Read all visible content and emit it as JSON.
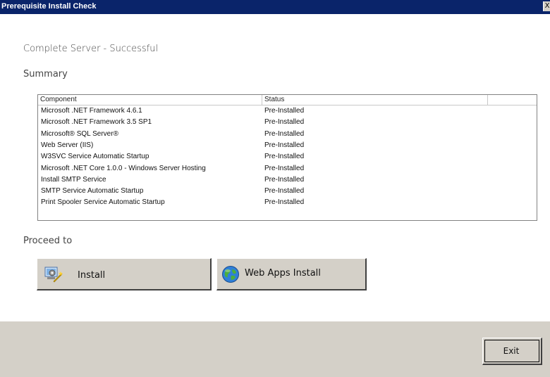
{
  "window": {
    "title": "Prerequisite Install Check",
    "close_glyph": "X"
  },
  "heading": "Complete Server - Successful",
  "summary_label": "Summary",
  "table": {
    "columns": [
      "Component",
      "Status",
      ""
    ],
    "rows": [
      {
        "component": "Microsoft .NET Framework 4.6.1",
        "status": "Pre-Installed"
      },
      {
        "component": "Microsoft .NET Framework 3.5 SP1",
        "status": "Pre-Installed"
      },
      {
        "component": "Microsoft® SQL Server®",
        "status": "Pre-Installed"
      },
      {
        "component": "Web Server (IIS)",
        "status": "Pre-Installed"
      },
      {
        "component": "W3SVC Service Automatic Startup",
        "status": "Pre-Installed"
      },
      {
        "component": "Microsoft .NET Core 1.0.0 - Windows Server Hosting",
        "status": "Pre-Installed"
      },
      {
        "component": "Install SMTP Service",
        "status": "Pre-Installed"
      },
      {
        "component": "SMTP Service Automatic Startup",
        "status": "Pre-Installed"
      },
      {
        "component": "Print Spooler Service Automatic Startup",
        "status": "Pre-Installed"
      }
    ]
  },
  "proceed_label": "Proceed to",
  "buttons": {
    "install": {
      "label": "Install",
      "icon": "install-wizard-icon"
    },
    "web_apps": {
      "label": "Web Apps Install",
      "icon": "globe-icon"
    },
    "exit": {
      "label": "Exit"
    }
  },
  "colors": {
    "titlebar": "#0a246a",
    "footer": "#d4d0c8",
    "button_face": "#d4d0c8"
  }
}
